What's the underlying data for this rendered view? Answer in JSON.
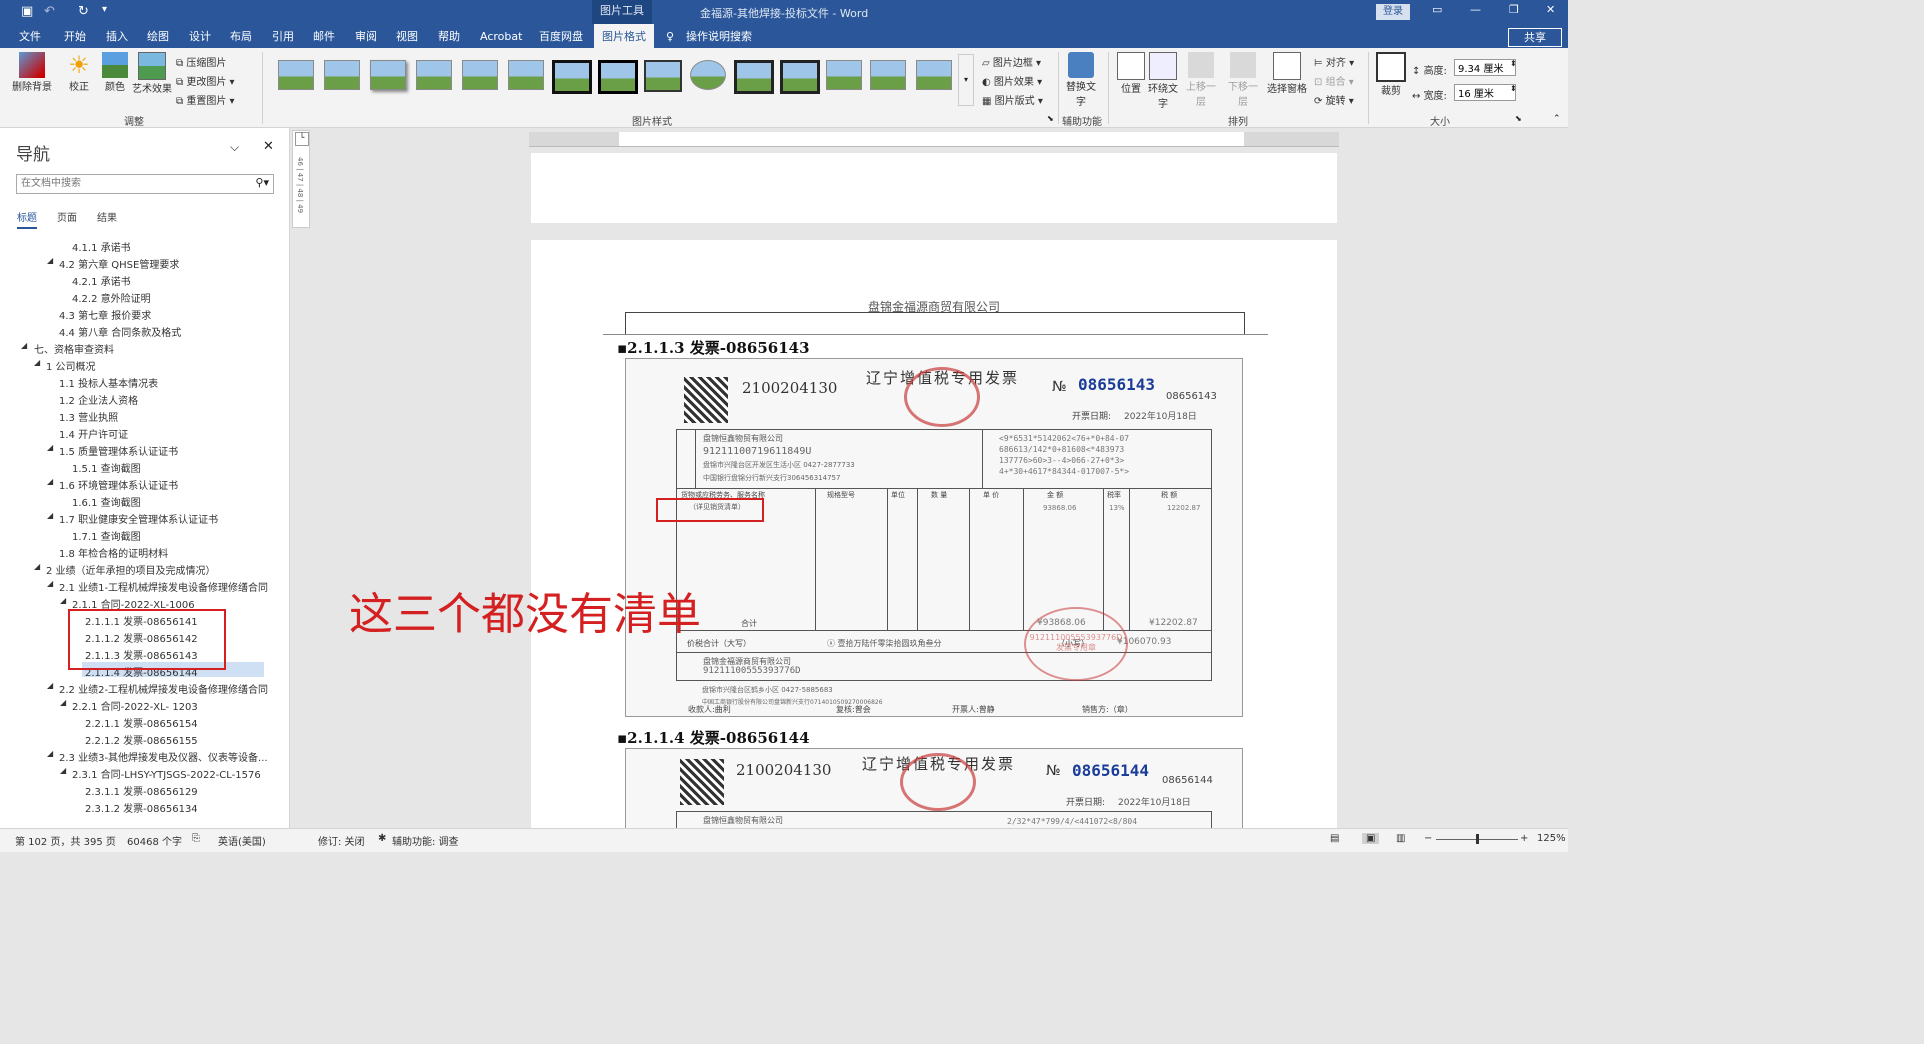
{
  "titlebar": {
    "context_tab": "图片工具",
    "doc_title": "金福源-其他焊接-投标文件  -  Word",
    "login": "登录"
  },
  "tabs": [
    "文件",
    "开始",
    "插入",
    "绘图",
    "设计",
    "布局",
    "引用",
    "邮件",
    "审阅",
    "视图",
    "帮助",
    "Acrobat",
    "百度网盘",
    "图片格式"
  ],
  "search_tab": "操作说明搜索",
  "share": "共享",
  "ribbon": {
    "remove_bg": "删除背景",
    "correct": "校正",
    "color": "颜色",
    "art": "艺术效果",
    "compress": "压缩图片",
    "change": "更改图片",
    "reset": "重置图片",
    "group_adjust": "调整",
    "group_styles": "图片样式",
    "border": "图片边框",
    "effect": "图片效果",
    "layout": "图片版式",
    "alt_text": "替换文字",
    "group_access": "辅助功能",
    "position": "位置",
    "wrap": "环绕文字",
    "forward": "上移一层",
    "backward": "下移一层",
    "selpane": "选择窗格",
    "align": "对齐",
    "groupobj": "组合",
    "rotate": "旋转",
    "group_arrange": "排列",
    "crop": "裁剪",
    "height_label": "高度:",
    "height_value": "9.34 厘米",
    "width_label": "宽度:",
    "width_value": "16 厘米",
    "group_size": "大小"
  },
  "nav": {
    "title": "导航",
    "search_placeholder": "在文档中搜索",
    "tabs": [
      "标题",
      "页面",
      "结果"
    ],
    "items": [
      "4.1.1 承诺书",
      "4.2 第六章 QHSE管理要求",
      "4.2.1 承诺书",
      "4.2.2 意外险证明",
      "4.3 第七章 报价要求",
      "4.4 第八章 合同条款及格式",
      "七、资格审查资料",
      "1 公司概况",
      "1.1 投标人基本情况表",
      "1.2 企业法人资格",
      "1.3 营业执照",
      "1.4 开户许可证",
      "1.5 质量管理体系认证证书",
      "1.5.1 查询截图",
      "1.6 环境管理体系认证证书",
      "1.6.1 查询截图",
      "1.7 职业健康安全管理体系认证证书",
      "1.7.1 查询截图",
      "1.8 年检合格的证明材料",
      "2 业绩（近年承担的项目及完成情况）",
      "2.1 业绩1-工程机械焊接发电设备修理修缮合同",
      "2.1.1 合同-2022-XL-1006",
      "2.1.1.1 发票-08656141",
      "2.1.1.2 发票-08656142",
      "2.1.1.3 发票-08656143",
      "2.1.1.4 发票-08656144",
      "2.2 业绩2-工程机械焊接发电设备修理修缮合同",
      "2.2.1 合同-2022-XL- 1203",
      "2.2.1.1 发票-08656154",
      "2.2.1.2 发票-08656155",
      "2.3 业绩3-其他焊接发电及仪器、仪表等设备...",
      "2.3.1 合同-LHSY-YTJSGS-2022-CL-1576",
      "2.3.1.1 发票-08656129",
      "2.3.1.2 发票-08656134"
    ]
  },
  "doc": {
    "header": "盘锦金福源商贸有限公司",
    "heading1": "2.1.1.3 发票-08656143",
    "heading2": "2.1.1.4 发票-08656144",
    "annotation": "这三个都没有清单",
    "invoice1": {
      "code": "2100204130",
      "title": "辽宁增值税专用发票",
      "no_label": "№",
      "number": "08656143",
      "number_small": "08656143",
      "date_label": "开票日期:",
      "date": "2022年10月18日",
      "buyer_name": "盘锦恒鑫物贸有限公司",
      "buyer_tax": "91211100719611849U",
      "buyer_addr": "盘锦市兴隆台区开发区生活小区 0427-2877733",
      "buyer_bank": "中国银行盘锦分行新兴支行306456314757",
      "cipher": [
        "<9*6531*5142062<76+*0+84-07",
        "686613/142*0+81608<*483973",
        "137776>60>3--4>066-27+0*3>",
        "4+*30+4617*84344-017007-5*>"
      ],
      "item_col": "货物或应税劳务、服务名称",
      "item": "（详见销货清单）",
      "spec": "规格型号",
      "unit": "单位",
      "qty": "数 量",
      "price": "单 价",
      "amount": "金 额",
      "rate": "税率",
      "tax": "税 额",
      "amount_val": "93868.06",
      "rate_val": "13%",
      "tax_val": "12202.87",
      "total_label": "合计",
      "total_amount": "¥93868.06",
      "total_tax": "¥12202.87",
      "grand_label": "价税合计（大写）",
      "grand_words": "ⓧ 壹拾万陆仟零柒拾圆玖角叁分",
      "grand_small_label": "（小写）",
      "grand_val": "¥106070.93",
      "seller_name": "盘锦金福源商贸有限公司",
      "seller_tax": "91211100555393776D",
      "seller_addr": "盘锦市兴隆台区鹤乡小区 0427-5885683",
      "seller_bank": "中国工商银行股份有限公司盘锦新兴支行0714010509270006826",
      "payee_label": "收款人:",
      "payee": "曲利",
      "review_label": "复核:",
      "review": "曾会",
      "drawer_label": "开票人:",
      "drawer": "曾静",
      "seller_label": "销售方:（章）",
      "stamp_text": "91211100555393776D 发票专用章"
    },
    "invoice2": {
      "code": "2100204130",
      "title": "辽宁增值税专用发票",
      "no_label": "№",
      "number": "08656144",
      "number_small": "08656144",
      "date_label": "开票日期:",
      "date": "2022年10月18日",
      "buyer_name": "盘锦恒鑫物贸有限公司",
      "cipher": "2/32*47*799/4/<441072<8/804"
    }
  },
  "status": {
    "page": "第 102 页，共 395 页",
    "words": "60468 个字",
    "lang": "英语(美国)",
    "track": "修订: 关闭",
    "access": "辅助功能: 调查",
    "zoom": "125%"
  }
}
